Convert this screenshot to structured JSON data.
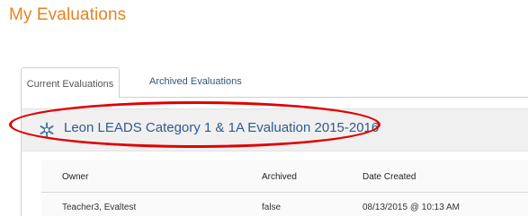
{
  "page_title": "My Evaluations",
  "tabs": [
    {
      "label": "Current Evaluations",
      "active": true
    },
    {
      "label": "Archived Evaluations",
      "active": false
    }
  ],
  "evaluation": {
    "title": "Leon LEADS Category 1 & 1A Evaluation 2015-2016",
    "icon": "snowflake-icon"
  },
  "table": {
    "headers": {
      "owner": "Owner",
      "archived": "Archived",
      "date_created": "Date Created"
    },
    "rows": [
      {
        "owner": "Teacher3, Evaltest",
        "archived": "false",
        "date_created": "08/13/2015 @ 10:13 AM"
      }
    ]
  },
  "colors": {
    "title_orange": "#e8821d",
    "link_blue": "#2e5877",
    "highlight_red": "#e00000"
  }
}
